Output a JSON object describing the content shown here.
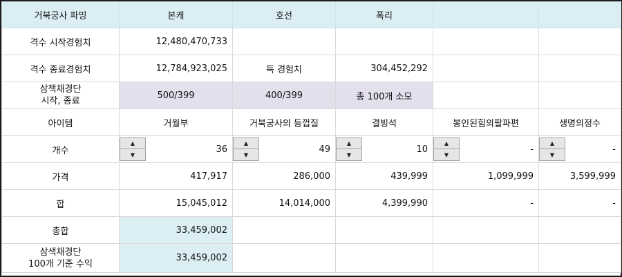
{
  "header": {
    "col1": "거북궁사 파밍",
    "col2": "본캐",
    "col3": "호선",
    "col4": "폭리"
  },
  "start_exp": {
    "label": "격수 시작경험치",
    "value": "12,480,470,733"
  },
  "end_exp": {
    "label": "격수 종료경험치",
    "value": "12,784,923,025",
    "gain_label": "득 경험치",
    "gain_value": "304,452,292"
  },
  "scroll": {
    "label_line1": "삼책채경단",
    "label_line2": "시작, 종료",
    "c2": "500/399",
    "c3": "400/399",
    "c4": "총 100개 소모"
  },
  "items": {
    "label": "아이템",
    "names": [
      "거월부",
      "거북궁사의 등껍질",
      "결빙석",
      "봉인된힘의팔파편",
      "생명의정수"
    ]
  },
  "count": {
    "label": "개수",
    "values": [
      "36",
      "49",
      "10",
      "-",
      "-"
    ]
  },
  "price": {
    "label": "가격",
    "values": [
      "417,917",
      "286,000",
      "439,999",
      "1,099,999",
      "3,599,999"
    ]
  },
  "subtotal": {
    "label": "합",
    "values": [
      "15,045,012",
      "14,014,000",
      "4,399,990",
      "-",
      "-"
    ]
  },
  "total": {
    "label": "총합",
    "value": "33,459,002"
  },
  "profit": {
    "label_line1": "삼색채경단",
    "label_line2": "100개 기준 수익",
    "value": "33,459,002"
  },
  "spinner": {
    "up_icon": "▲",
    "down_icon": "▼"
  },
  "colors": {
    "header_bg": "#dbeef4",
    "highlight_lavender": "#e4dfec",
    "highlight_blue": "#dbeef4"
  }
}
